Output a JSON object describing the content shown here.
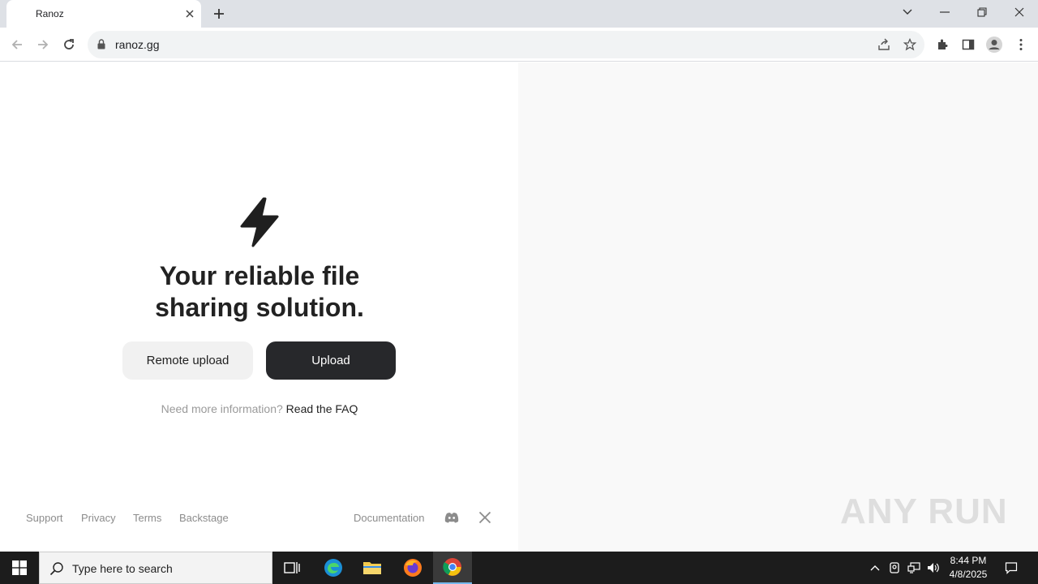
{
  "browser": {
    "tab_title": "Ranoz",
    "url": "ranoz.gg"
  },
  "hero": {
    "headline_line1": "Your reliable file",
    "headline_line2": "sharing solution.",
    "remote_upload_label": "Remote upload",
    "upload_label": "Upload",
    "info_text": "Need more information?",
    "faq_link": "Read the FAQ"
  },
  "footer": {
    "support": "Support",
    "privacy": "Privacy",
    "terms": "Terms",
    "backstage": "Backstage",
    "documentation": "Documentation"
  },
  "watermark": "ANY RUN",
  "taskbar": {
    "search_placeholder": "Type here to search",
    "time": "8:44 PM",
    "date": "4/8/2025"
  },
  "colors": {
    "primary_button": "#27282b",
    "secondary_button": "#f1f1f1",
    "right_panel": "#f9f9f9"
  }
}
